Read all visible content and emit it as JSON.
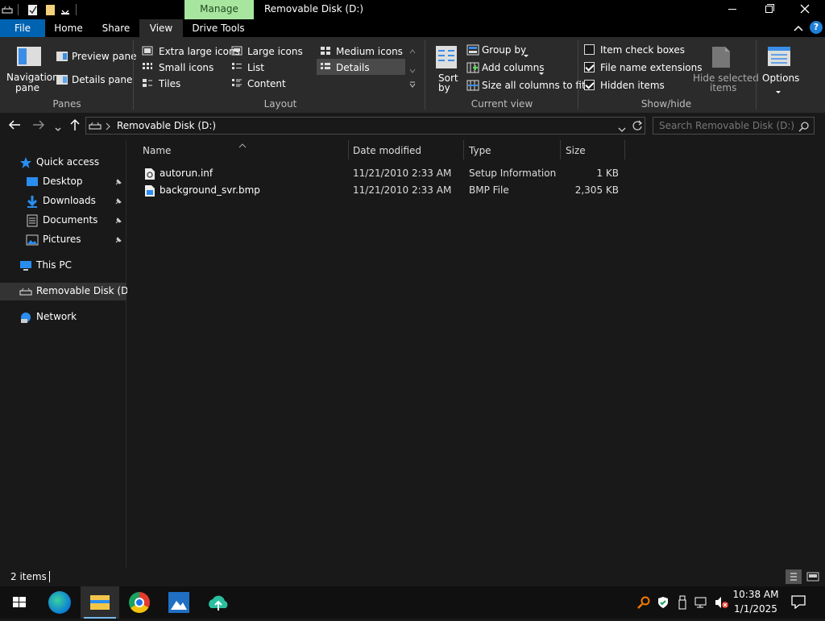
{
  "window": {
    "title": "Removable Disk (D:)",
    "context_tab": "Manage",
    "context_tab_color": "#a8e6a0",
    "accent": "#0063b1"
  },
  "tabs": {
    "file": "File",
    "home": "Home",
    "share": "Share",
    "view": "View",
    "drive_tools": "Drive Tools"
  },
  "ribbon": {
    "panes": {
      "navigation_pane_l1": "Navigation",
      "navigation_pane_l2": "pane",
      "preview_pane": "Preview pane",
      "details_pane": "Details pane",
      "group_label": "Panes"
    },
    "layout": {
      "extra_large_icons": "Extra large icons",
      "large_icons": "Large icons",
      "medium_icons": "Medium icons",
      "small_icons": "Small icons",
      "list": "List",
      "details": "Details",
      "tiles": "Tiles",
      "content": "Content",
      "group_label": "Layout"
    },
    "current_view": {
      "sort_by_l1": "Sort",
      "sort_by_l2": "by",
      "group_by": "Group by",
      "add_columns": "Add columns",
      "size_all_columns": "Size all columns to fit",
      "group_label": "Current view"
    },
    "show_hide": {
      "item_check_boxes": "Item check boxes",
      "item_check_boxes_checked": false,
      "file_name_extensions": "File name extensions",
      "file_name_extensions_checked": true,
      "hidden_items": "Hidden items",
      "hidden_items_checked": true,
      "hide_selected_l1": "Hide selected",
      "hide_selected_l2": "items",
      "group_label": "Show/hide"
    },
    "options": "Options"
  },
  "address": {
    "path": "Removable Disk (D:)",
    "search_placeholder": "Search Removable Disk (D:)"
  },
  "nav": {
    "quick_access": "Quick access",
    "desktop": "Desktop",
    "downloads": "Downloads",
    "documents": "Documents",
    "pictures": "Pictures",
    "this_pc": "This PC",
    "removable_disk": "Removable Disk (D:)",
    "network": "Network"
  },
  "columns": {
    "name": "Name",
    "date_modified": "Date modified",
    "type": "Type",
    "size": "Size"
  },
  "files": [
    {
      "name": "autorun.inf",
      "date": "11/21/2010 2:33 AM",
      "type": "Setup Information",
      "size": "1 KB"
    },
    {
      "name": "background_svr.bmp",
      "date": "11/21/2010 2:33 AM",
      "type": "BMP File",
      "size": "2,305 KB"
    }
  ],
  "status": {
    "item_count": "2 items"
  },
  "taskbar": {
    "time": "10:38 AM",
    "date": "1/1/2025"
  }
}
